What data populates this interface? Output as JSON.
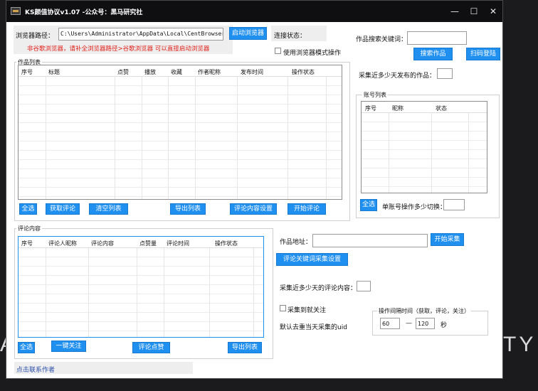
{
  "desktop": {
    "bg_text_left": "A",
    "bg_text_right": "TY"
  },
  "window": {
    "title": "KS颜值协议v1.07 -公众号：黑马研究社",
    "controls": {
      "minimize": "—",
      "maximize": "☐",
      "close": "✕"
    }
  },
  "browser": {
    "path_label": "浏览器路径：",
    "path_value": "C:\\Users\\Administrator\\AppData\\Local\\CentBrowser\\Application\\chrome.exe",
    "launch_button": "启动浏览器",
    "status_label": "连接状态：",
    "warning": "非谷歌浏览器，请补全浏览器路径>谷歌浏览器 可以直接启动浏览器",
    "browser_mode_checkbox": "使用浏览器模式操作"
  },
  "works": {
    "title": "作品列表",
    "columns": [
      "序号",
      "标题",
      "点赞",
      "播放",
      "收藏",
      "作者昵称",
      "发布时间",
      "操作状态"
    ],
    "buttons": {
      "select_all": "全选",
      "get_comments": "获取评论",
      "clear_list": "清空列表",
      "export_list": "导出列表",
      "comment_settings": "评论内容设置",
      "start_comment": "开始评论"
    }
  },
  "search": {
    "keyword_label": "作品搜索关键词：",
    "keyword_value": "",
    "search_button": "搜索作品",
    "scan_login_button": "扫码登陆",
    "recent_days_label": "采集近多少天发布的作品：",
    "recent_days_value": ""
  },
  "accounts": {
    "title": "账号列表",
    "columns": [
      "序号",
      "昵称",
      "状态"
    ],
    "select_all": "全选",
    "switch_label": "单账号操作多少切换：",
    "switch_value": ""
  },
  "comments": {
    "title": "评论内容",
    "columns": [
      "序号",
      "评论人昵称",
      "评论内容",
      "点赞量",
      "评论时间",
      "操作状态"
    ],
    "buttons": {
      "select_all": "全选",
      "follow_all": "一键关注",
      "like_comments": "评论点赞",
      "export_list": "导出列表"
    }
  },
  "collect": {
    "work_url_label": "作品地址：",
    "work_url_value": "",
    "start_collect_button": "开始采集",
    "keyword_settings_button": "评论关键词采集设置",
    "recent_comment_days_label": "采集近多少天的评论内容：",
    "recent_comment_days_value": "",
    "follow_checkbox": "采集到就关注",
    "dedupe_note": "默认去重当天采集的uid",
    "interval_title": "操作间隔时间（获取，评论，关注）",
    "interval_min": "60",
    "interval_separator": "—",
    "interval_max": "120",
    "interval_unit": "秒"
  },
  "footer": {
    "contact_link": "点击联系作者"
  }
}
